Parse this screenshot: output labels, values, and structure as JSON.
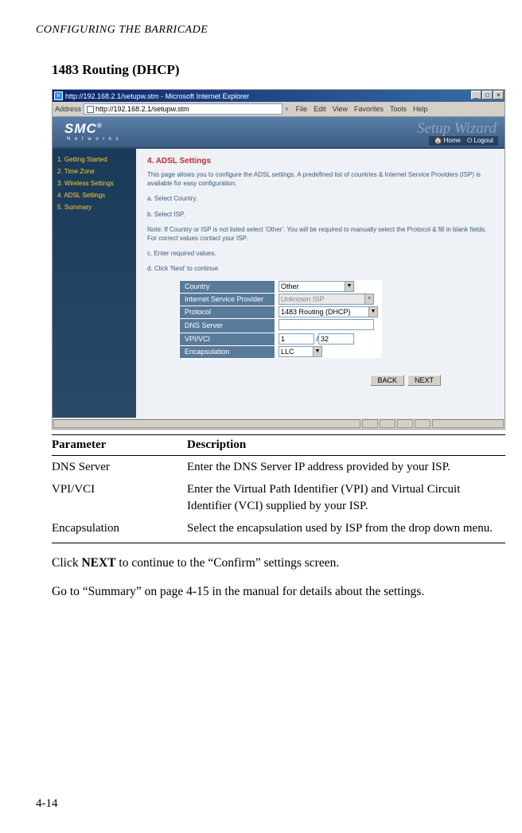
{
  "running_head": "CONFIGURING THE BARRICADE",
  "section_title": "1483 Routing (DHCP)",
  "ie": {
    "title": "http://192.168.2.1/setupw.stm - Microsoft Internet Explorer",
    "address_label": "Address",
    "address_value": "http://192.168.2.1/setupw.stm",
    "menu": [
      "File",
      "Edit",
      "View",
      "Favorites",
      "Tools",
      "Help"
    ]
  },
  "smc": {
    "logo": "SMC",
    "reg": "®",
    "tagline": "N e t w o r k s",
    "wizard": "Setup Wizard",
    "home": "Home",
    "logout": "Logout"
  },
  "sidebar": {
    "steps": [
      "1. Getting Started",
      "2. Time Zone",
      "3. Wireless Settings",
      "4. ADSL Settings",
      "5. Summary"
    ]
  },
  "adsl": {
    "title": "4. ADSL Settings",
    "intro": "This page allows you to configure the ADSL settings. A predefined list of countries & Internet Service Providers (ISP) is available for easy configuration.",
    "step_a": "a. Select Country.",
    "step_b": "b. Select ISP.",
    "note": "Note: If Country or ISP is not listed select 'Other'. You will be required to manually select the Protocol & fill in blank fields. For correct values contact your ISP.",
    "step_c": "c. Enter required values.",
    "step_d": "d. Click 'Next' to continue",
    "rows": {
      "country_label": "Country",
      "country_value": "Other",
      "isp_label": "Internet Service Provider",
      "isp_value": "Unknown ISP",
      "protocol_label": "Protocol",
      "protocol_value": "1483 Routing (DHCP)",
      "dns_label": "DNS Server",
      "dns_value": "",
      "vpi_label": "VPI/VCI",
      "vpi_value": "1",
      "vci_value": "32",
      "encap_label": "Encapsulation",
      "encap_value": "LLC"
    },
    "back": "BACK",
    "next": "NEXT"
  },
  "param_table": {
    "h1": "Parameter",
    "h2": "Description",
    "rows": [
      {
        "p": "DNS Server",
        "d": "Enter the DNS Server IP address provided by your ISP."
      },
      {
        "p": "VPI/VCI",
        "d": "Enter the Virtual Path Identifier (VPI) and Virtual Circuit Identifier (VCI) supplied by your ISP."
      },
      {
        "p": "Encapsulation",
        "d": "Select the encapsulation used by ISP from the drop down menu."
      }
    ]
  },
  "para1_pre": "Click ",
  "para1_bold": "NEXT",
  "para1_post": " to continue to the “Confirm” settings screen.",
  "para2": "Go to “Summary” on page 4-15 in the manual for details about the settings.",
  "page_number": "4-14"
}
